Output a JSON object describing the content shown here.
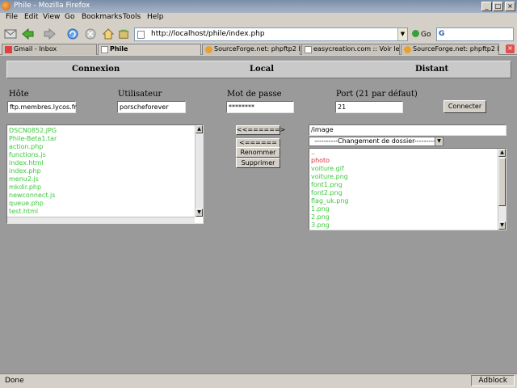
{
  "window": {
    "title": "Phile - Mozilla Firefox"
  },
  "menu": [
    "File",
    "Edit",
    "View",
    "Go",
    "Bookmarks",
    "Tools",
    "Help"
  ],
  "toolbar": {
    "url": "http://localhost/phile/index.php",
    "go_label": "Go",
    "search_logo": "G"
  },
  "tabs": [
    {
      "label": "Gmail - Inbox",
      "icon": "gmail-icon"
    },
    {
      "label": "Phile",
      "icon": "page-icon"
    },
    {
      "label": "SourceForge.net: phpftp2 Pr...",
      "icon": "sourceforge-icon"
    },
    {
      "label": "easycreation.com :: Voir le s...",
      "icon": "page-icon"
    },
    {
      "label": "SourceForge.net: phpftp2 Pr...",
      "icon": "sourceforge-icon"
    }
  ],
  "header": {
    "connexion": "Connexion",
    "local": "Local",
    "distant": "Distant"
  },
  "form": {
    "host_label": "Hôte",
    "host_value": "ftp.membres.lycos.fr",
    "user_label": "Utilisateur",
    "user_value": "porscheforever",
    "pass_label": "Mot de passe",
    "pass_value": "********",
    "port_label": "Port (21 par défaut)",
    "port_value": "21",
    "connect_button": "Connecter"
  },
  "local_files": [
    "DSCN0852.JPG",
    "Phile-Beta1.tar",
    "action.php",
    "functions.js",
    "index.html",
    "index.php",
    "menu2.js",
    "mkdir.php",
    "newconnect.js",
    "queue.php",
    "test.html"
  ],
  "actions": {
    "upload": "<<======>",
    "download": "<======",
    "rename": "Renommer",
    "delete": "Supprimer"
  },
  "remote": {
    "path": "/image",
    "folder_select": "----------Changement de dossier----------",
    "files": [
      {
        "name": "..",
        "type": "dir"
      },
      {
        "name": "photo",
        "type": "dir"
      },
      {
        "name": "voiture.gif",
        "type": "file"
      },
      {
        "name": "voiture.png",
        "type": "file"
      },
      {
        "name": "font1.png",
        "type": "file"
      },
      {
        "name": "font2.png",
        "type": "file"
      },
      {
        "name": "flag_uk.png",
        "type": "file"
      },
      {
        "name": "1.png",
        "type": "file"
      },
      {
        "name": "2.png",
        "type": "file"
      },
      {
        "name": "3.png",
        "type": "file"
      }
    ]
  },
  "status": {
    "text": "Done",
    "adblock": "Adblock"
  },
  "colors": {
    "file": "#3cc83c",
    "dir": "#e03030",
    "content_bg": "#9a9a9a"
  }
}
